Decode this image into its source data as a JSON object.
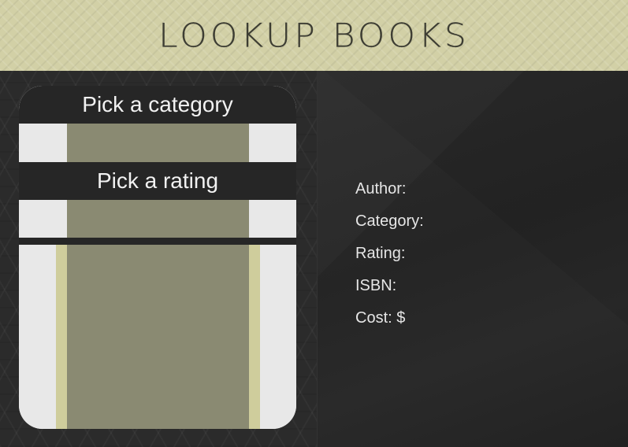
{
  "header": {
    "title": "LOOKUP BOOKS"
  },
  "picker": {
    "category_label": "Pick a category",
    "rating_label": "Pick a rating"
  },
  "details": {
    "author_label": "Author:",
    "category_label": "Category:",
    "rating_label": "Rating:",
    "isbn_label": "ISBN:",
    "cost_label": "Cost: $"
  },
  "colors": {
    "header_bg": "#d2d0a6",
    "panel_dark": "#2b2b2b",
    "bar": "#262626",
    "olive": "#8a8a72",
    "olive_light": "#cfcd9c",
    "card_light": "#e3e4e4"
  }
}
